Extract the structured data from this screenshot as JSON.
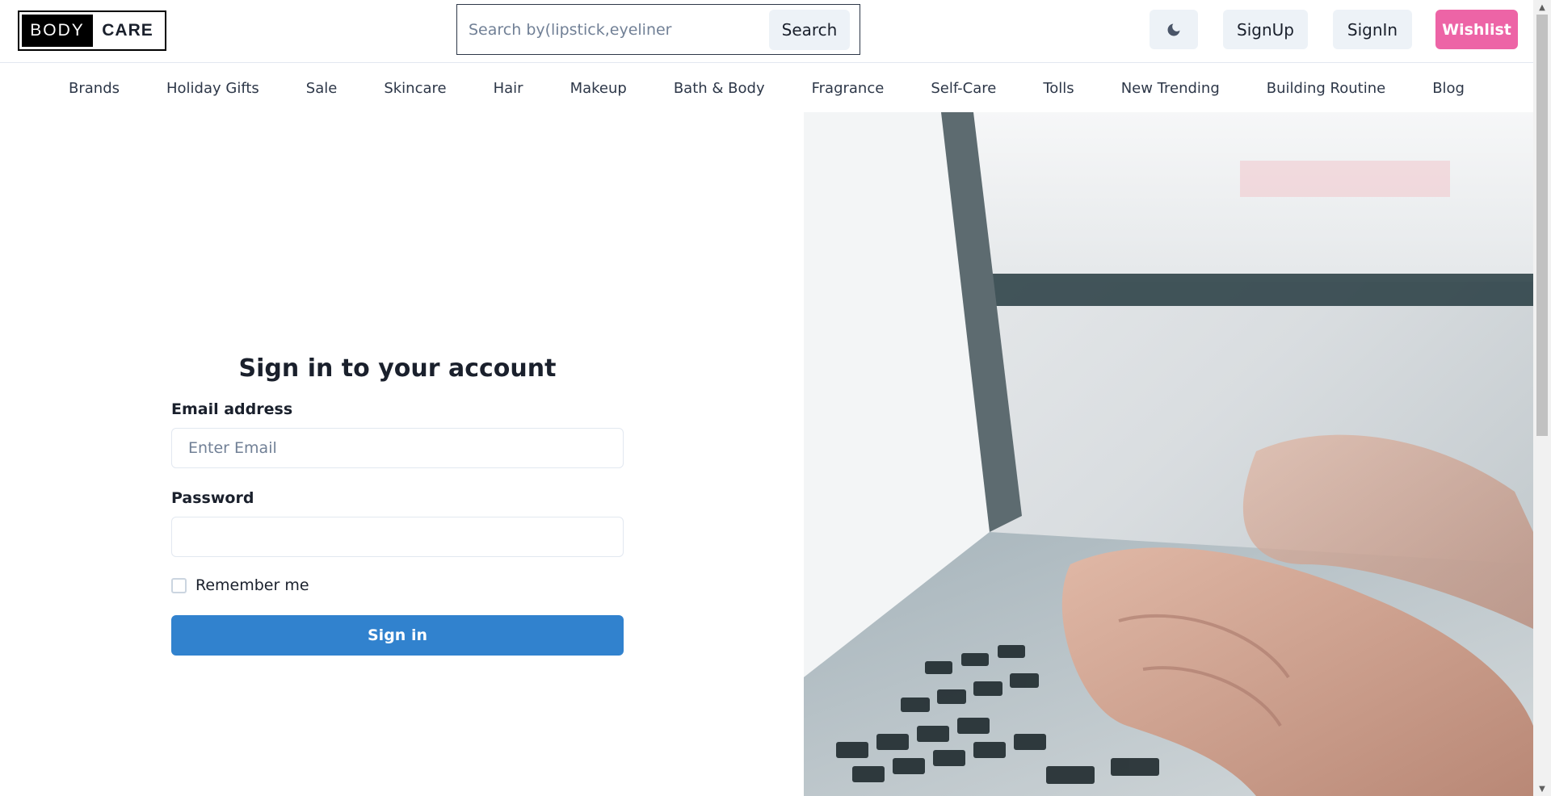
{
  "brand": {
    "part1": "BODY",
    "part2": "CARE"
  },
  "search": {
    "placeholder": "Search by(lipstick,eyeliner",
    "button_label": "Search"
  },
  "header_actions": {
    "theme_icon": "moon-icon",
    "signup_label": "SignUp",
    "signin_label": "SignIn",
    "wishlist_label": "Wishlist"
  },
  "nav": {
    "items": [
      "Brands",
      "Holiday Gifts",
      "Sale",
      "Skincare",
      "Hair",
      "Makeup",
      "Bath & Body",
      "Fragrance",
      "Self-Care",
      "Tolls",
      "New Trending",
      "Building Routine",
      "Blog"
    ]
  },
  "signin_form": {
    "title": "Sign in to your account",
    "email_label": "Email address",
    "email_placeholder": "Enter Email",
    "email_value": "",
    "password_label": "Password",
    "password_value": "",
    "remember_label": "Remember me",
    "remember_checked": false,
    "submit_label": "Sign in"
  },
  "colors": {
    "wishlist": "#ed64a6",
    "primary": "#3182ce",
    "button_gray": "#edf2f7"
  },
  "hero_image": {
    "subject": "hands-typing-on-laptop-photo"
  }
}
